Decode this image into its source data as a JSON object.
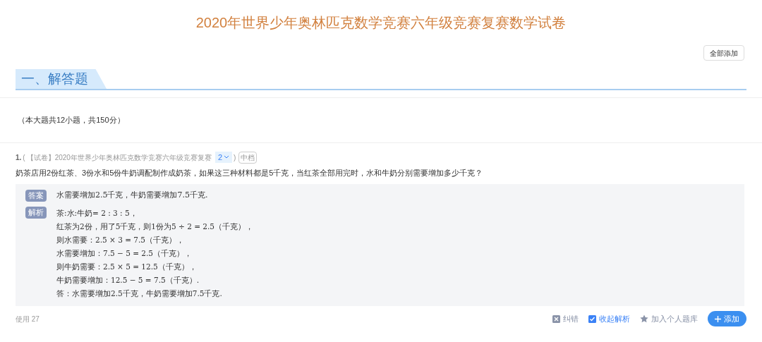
{
  "title": "2020年世界少年奥林匹克数学竞赛六年级竞赛复赛数学试卷",
  "add_all_button": "全部添加",
  "section": {
    "title": "一、解答题",
    "summary": "（本大题共12小题，共150分）"
  },
  "questions": [
    {
      "number": "1.",
      "open_paren": "(",
      "source": "【试卷】2020年世界少年奥林匹克数学竞赛六年级竞赛复赛",
      "version": "2",
      "close_paren": ")",
      "difficulty": "中档",
      "text": "奶茶店用2份红茶、3份水和5份牛奶调配制作成奶茶，如果这三种材料都是5千克，当红茶全部用完时，水和牛奶分别需要增加多少千克？",
      "answer_label": "答案",
      "answer": "水需要增加2.5千克，牛奶需要增加7.5千克.",
      "analysis_label": "解析",
      "analysis_lines": [
        "茶:水:牛奶= 2 : 3 : 5，",
        "红茶为2份，用了5千克，则1份为5 ÷ 2 = 2.5（千克），",
        "则水需要：2.5 × 3 = 7.5（千克），",
        "水需要增加：7.5 − 5 = 2.5（千克），",
        "则牛奶需要：2.5 × 5 = 12.5（千克），",
        "牛奶需要增加：12.5 − 5 = 7.5（千克）.",
        "答：水需要增加2.5千克，牛奶需要增加7.5千克."
      ],
      "usage": "使用 27",
      "actions": [
        {
          "kind": "report",
          "label": "纠错"
        },
        {
          "kind": "collapse",
          "label": "收起解析",
          "checked": true
        },
        {
          "kind": "favorite",
          "label": "加入个人题库"
        }
      ],
      "add_button": "添加"
    }
  ]
}
